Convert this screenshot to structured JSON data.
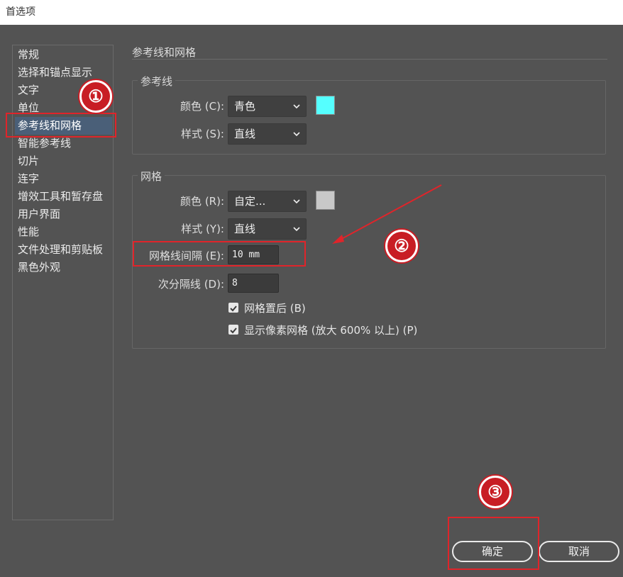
{
  "window": {
    "title": "首选项"
  },
  "sidebar": {
    "items": [
      {
        "label": "常规"
      },
      {
        "label": "选择和锚点显示"
      },
      {
        "label": "文字"
      },
      {
        "label": "单位"
      },
      {
        "label": "参考线和网格"
      },
      {
        "label": "智能参考线"
      },
      {
        "label": "切片"
      },
      {
        "label": "连字"
      },
      {
        "label": "增效工具和暂存盘"
      },
      {
        "label": "用户界面"
      },
      {
        "label": "性能"
      },
      {
        "label": "文件处理和剪贴板"
      },
      {
        "label": "黑色外观"
      }
    ],
    "selected": "参考线和网格"
  },
  "main": {
    "section_title": "参考线和网格",
    "guides": {
      "title": "参考线",
      "color_label": "颜色 (C):",
      "color_value": "青色",
      "color_swatch": "#55ffff",
      "style_label": "样式 (S):",
      "style_value": "直线"
    },
    "grid": {
      "title": "网格",
      "color_label": "颜色 (R):",
      "color_value": "自定...",
      "color_swatch": "#c8c8c8",
      "style_label": "样式 (Y):",
      "style_value": "直线",
      "gridline_label": "网格线间隔 (E):",
      "gridline_value": "10 mm",
      "subdiv_label": "次分隔线 (D):",
      "subdiv_value": "8",
      "grids_in_back_label": "网格置后 (B)",
      "grids_in_back_checked": true,
      "pixel_grid_label": "显示像素网格 (放大 600% 以上) (P)",
      "pixel_grid_checked": true
    }
  },
  "footer": {
    "ok_label": "确定",
    "cancel_label": "取消"
  },
  "annotations": {
    "step1": "①",
    "step2": "②",
    "step3": "③"
  },
  "colors": {
    "highlight_red": "#e0242a",
    "selection_blue": "#4a5f78"
  }
}
